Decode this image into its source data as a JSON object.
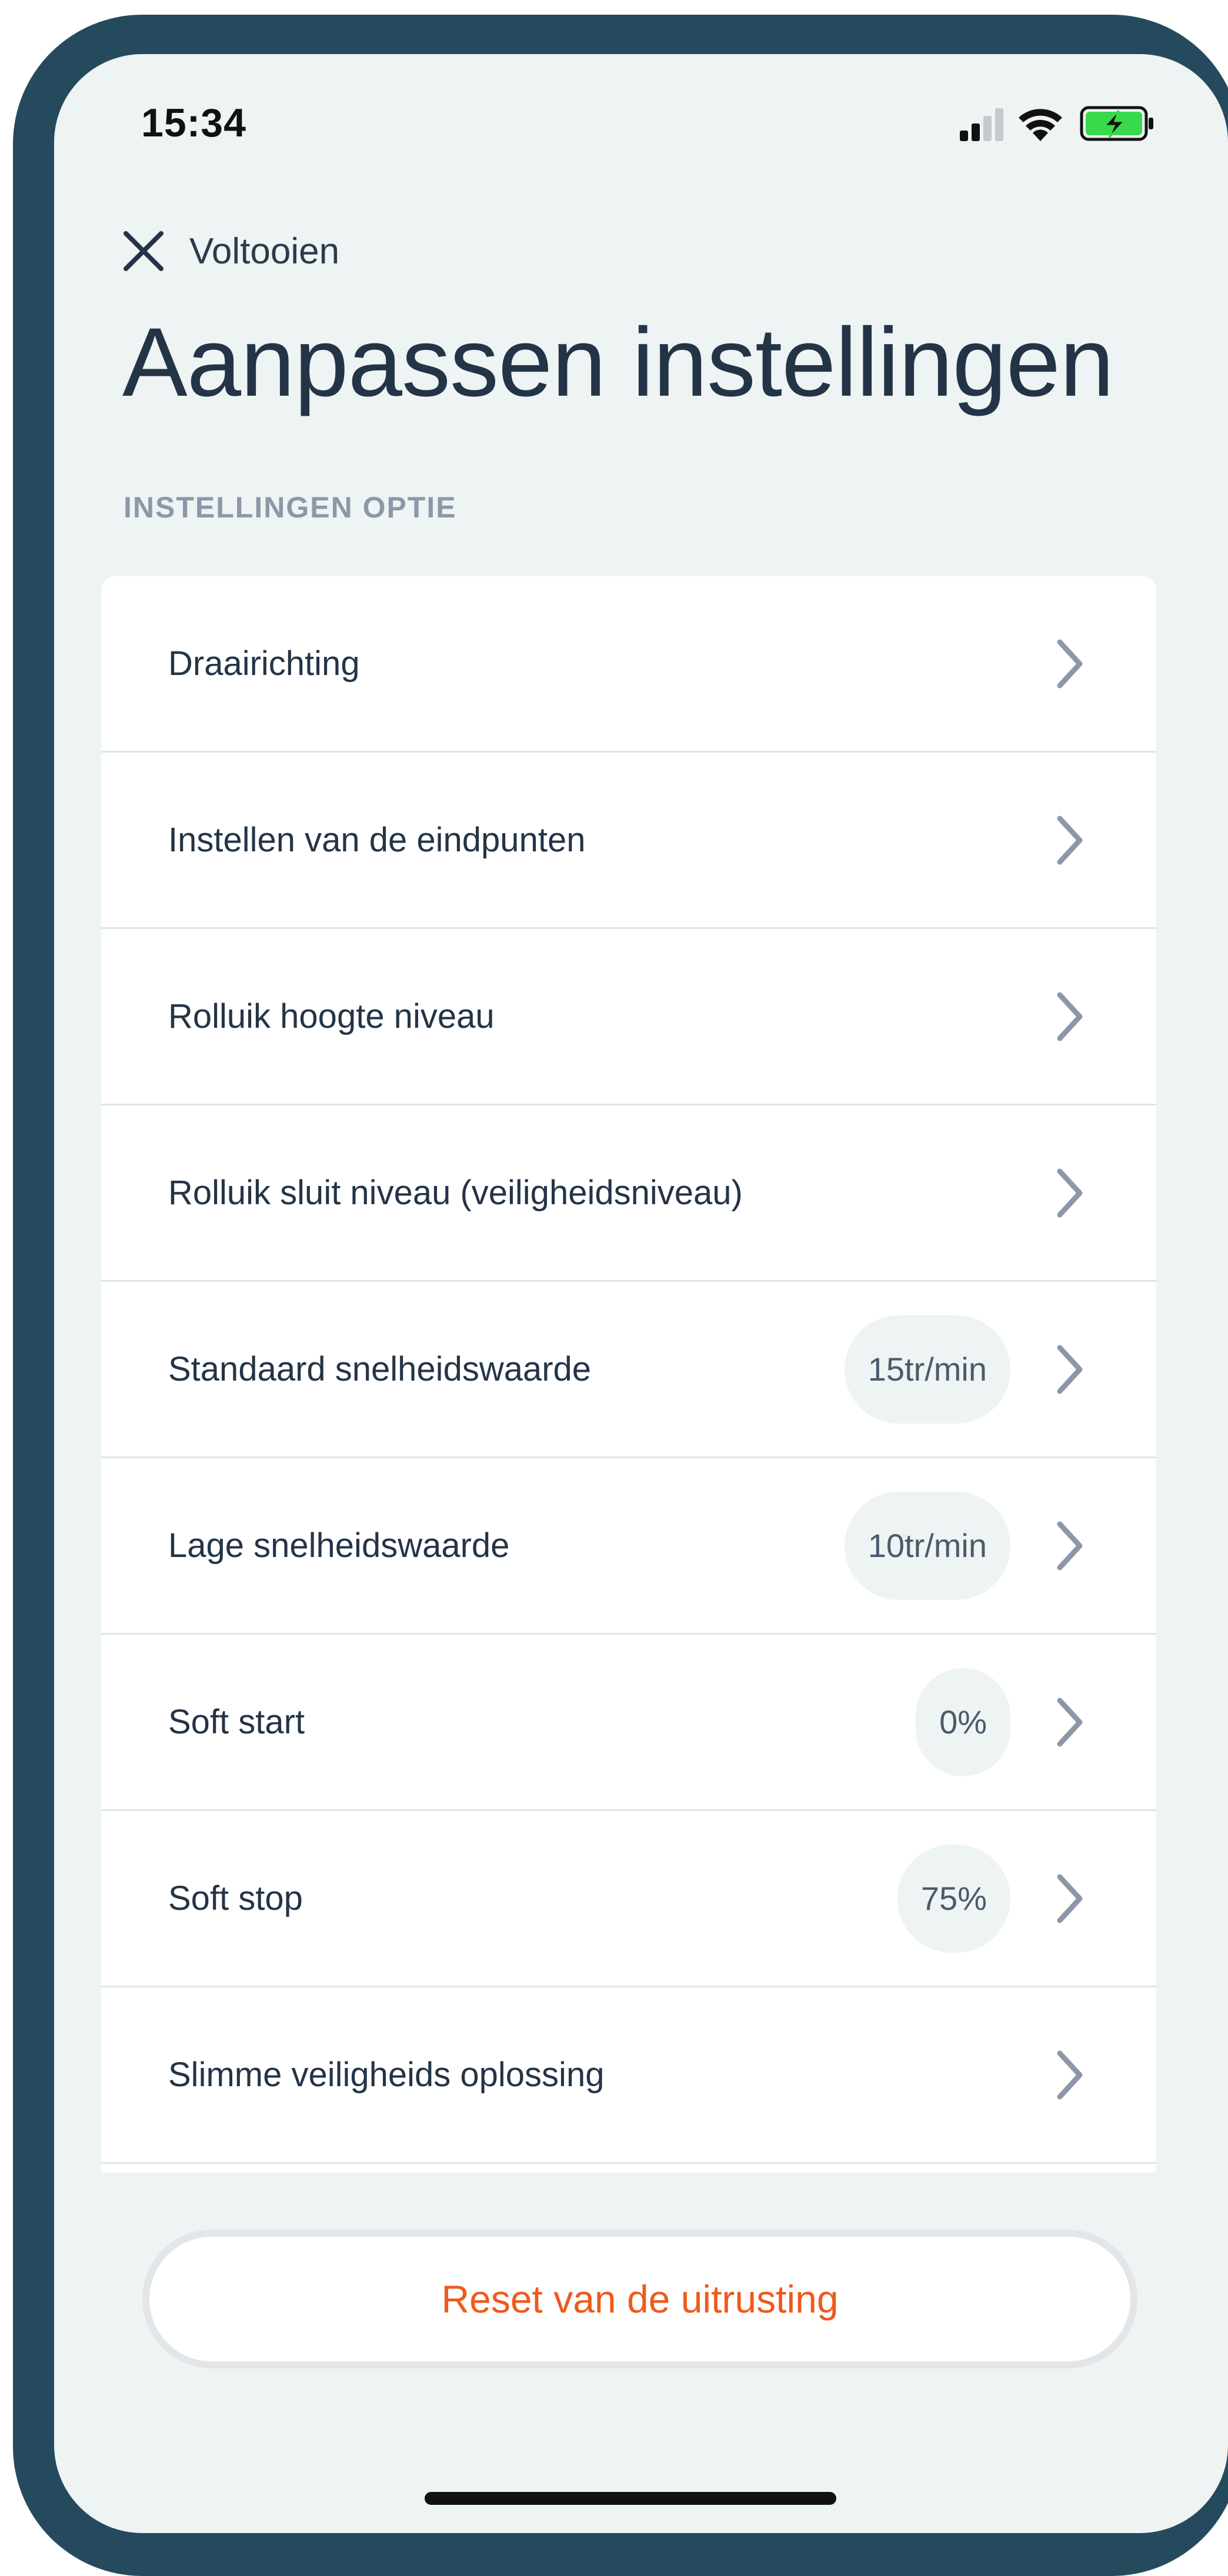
{
  "status_bar": {
    "time": "15:34",
    "icons": [
      "signal-icon",
      "wifi-icon",
      "battery-charging-icon"
    ],
    "battery_color": "#38d94a"
  },
  "header": {
    "close_label": "Voltooien",
    "close_icon": "close-icon",
    "title": "Aanpassen instellingen"
  },
  "section": {
    "label": "INSTELLINGEN OPTIE"
  },
  "settings": [
    {
      "label": "Draairichting",
      "value": ""
    },
    {
      "label": "Instellen van de eindpunten",
      "value": ""
    },
    {
      "label": "Rolluik hoogte niveau",
      "value": ""
    },
    {
      "label": "Rolluik sluit niveau (veiligheidsniveau)",
      "value": ""
    },
    {
      "label": "Standaard snelheidswaarde",
      "value": "15tr/min"
    },
    {
      "label": "Lage snelheidswaarde",
      "value": "10tr/min"
    },
    {
      "label": "Soft start",
      "value": "0%"
    },
    {
      "label": "Soft stop",
      "value": "75%"
    },
    {
      "label": "Slimme veiligheids oplossing",
      "value": ""
    }
  ],
  "footer": {
    "reset_label": "Reset van de uitrusting"
  },
  "colors": {
    "frame": "#264a5d",
    "background": "#eef3f3",
    "accent": "#ee5a1b",
    "text": "#243447"
  }
}
